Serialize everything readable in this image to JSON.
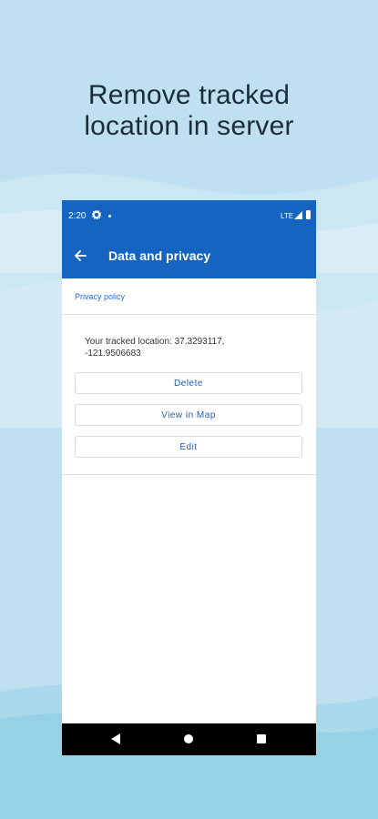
{
  "headline": {
    "line1": "Remove tracked",
    "line2": "location in server"
  },
  "status_bar": {
    "time": "2:20",
    "network": "LTE",
    "icons": [
      "gear-icon",
      "notification-dot-icon",
      "signal-icon",
      "battery-icon"
    ]
  },
  "app_bar": {
    "title": "Data and privacy",
    "back_icon": "arrow-left-icon"
  },
  "privacy_link": "Privacy policy",
  "tracked_location": {
    "line1": "Your tracked location: 37.3293117,",
    "line2": "-121.9506683"
  },
  "buttons": {
    "delete": "Delete",
    "view_in_map": "View in Map",
    "edit": "Edit"
  },
  "nav_bar": {
    "icons": [
      "nav-back-icon",
      "nav-home-icon",
      "nav-recents-icon"
    ]
  },
  "colors": {
    "primary": "#1565c0",
    "background": "#bfe0f1",
    "link": "#1e6fd9"
  }
}
